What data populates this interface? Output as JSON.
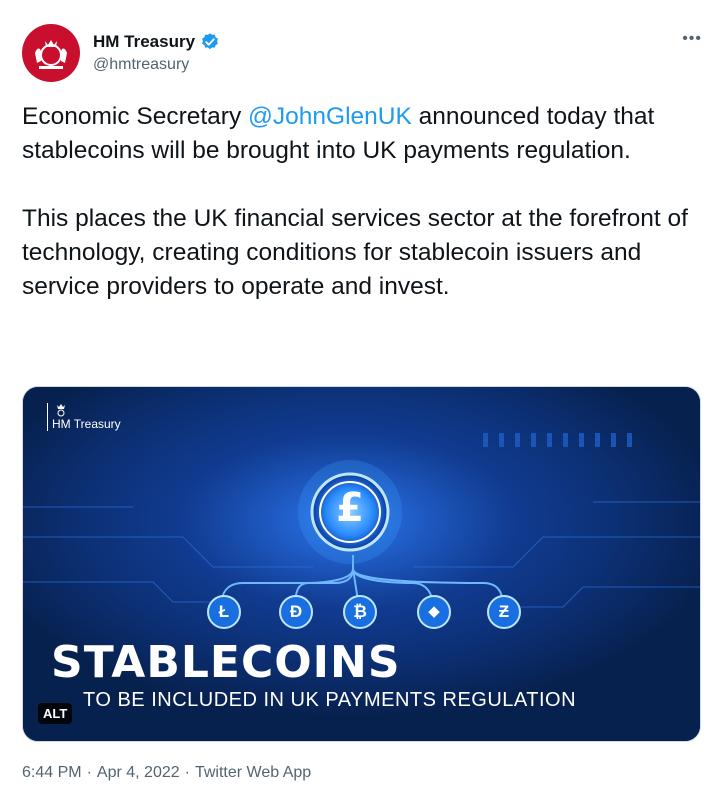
{
  "author": {
    "display_name": "HM Treasury",
    "handle": "@hmtreasury",
    "verified": true,
    "avatar_icon": "royal-crest-icon",
    "avatar_color": "#c8102e"
  },
  "menu": {
    "more_label": "•••"
  },
  "tweet": {
    "paragraph1_before": "Economic Secretary ",
    "mention": "@JohnGlenUK",
    "paragraph1_after": " announced today that stablecoins will be brought into UK payments regulation.",
    "paragraph2": "This places the UK financial services sector at the forefront of technology, creating conditions for stablecoin issuers and service providers to operate and invest."
  },
  "media": {
    "brand_text": "HM Treasury",
    "headline": "STABLECOINS",
    "subheadline": "TO BE INCLUDED IN UK PAYMENTS REGULATION",
    "alt_badge": "ALT",
    "central_symbol": "£",
    "coin_symbols": [
      "Ł",
      "Đ",
      "₿",
      "◆",
      "Ƶ"
    ],
    "background_color": "#0a2a66",
    "glow_color": "#3aa0ff"
  },
  "footer": {
    "time": "6:44 PM",
    "date": "Apr 4, 2022",
    "source": "Twitter Web App",
    "separator": "·"
  },
  "colors": {
    "link": "#1d9bf0",
    "muted": "#536471",
    "text": "#0f1419"
  }
}
